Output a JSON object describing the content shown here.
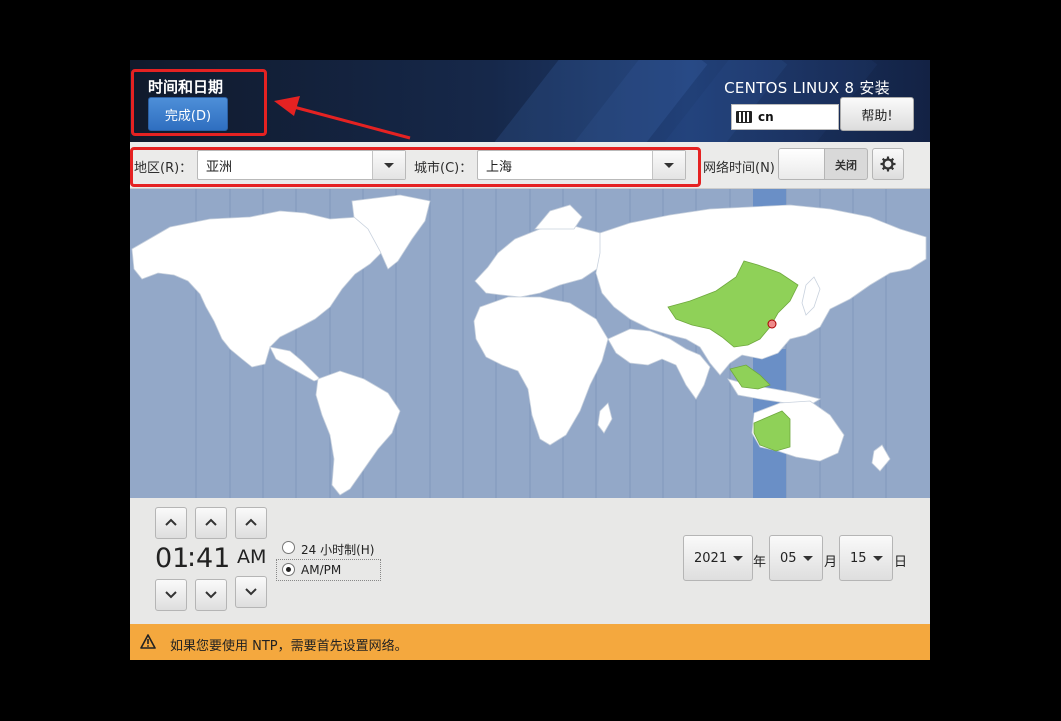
{
  "header": {
    "page_title": "时间和日期",
    "done_label": "完成(D)",
    "installer_title": "CENTOS LINUX 8 安装",
    "keyboard_layout": "cn",
    "help_label": "帮助!"
  },
  "selectors": {
    "region_label": "地区(R)：",
    "region_value": "亚洲",
    "city_label": "城市(C)：",
    "city_value": "上海",
    "network_time_label": "网络时间(N)",
    "network_time_state": "关闭"
  },
  "map": {
    "icons": [
      "world-map",
      "selected-city-marker"
    ],
    "colors": {
      "ocean": "#93a8c8",
      "land": "#ffffff",
      "selected_zone": "#8fd158",
      "selected_band": "#6a8fc6"
    }
  },
  "time": {
    "hours": "01",
    "separator": ":",
    "minutes": "41",
    "period": "AM",
    "format_24h_label": "24 小时制(H)",
    "format_ampm_label": "AM/PM",
    "selected_format": "AM/PM"
  },
  "date": {
    "year": "2021",
    "year_suffix": "年",
    "month": "05",
    "month_suffix": "月",
    "day": "15",
    "day_suffix": "日"
  },
  "warning": {
    "icon": "warning-icon",
    "text": "如果您要使用 NTP，需要首先设置网络。",
    "color": "#f4a83e"
  },
  "annotations": {
    "color": "#e52222"
  }
}
